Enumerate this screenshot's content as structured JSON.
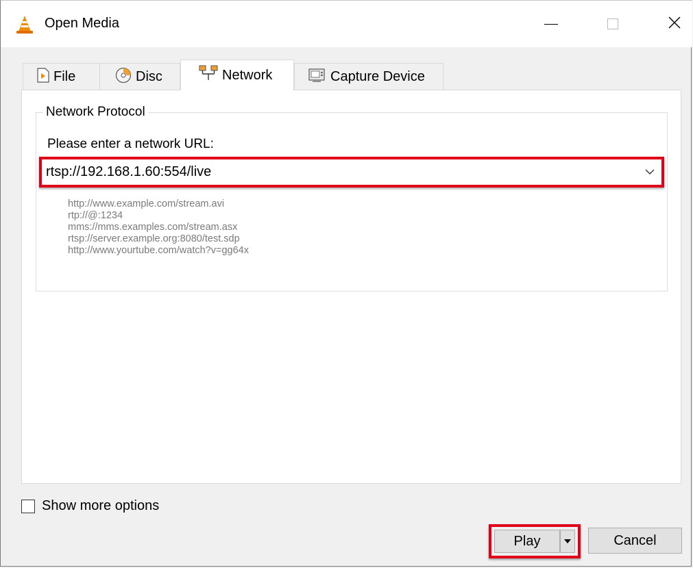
{
  "window": {
    "title": "Open Media",
    "app_icon": "vlc-cone-icon",
    "controls": [
      "minimize-icon",
      "maximize-icon",
      "close-icon"
    ]
  },
  "tabs": [
    {
      "label": "File",
      "icon": "file-play-icon"
    },
    {
      "label": "Disc",
      "icon": "disc-icon"
    },
    {
      "label": "Network",
      "icon": "network-icon",
      "active": true
    },
    {
      "label": "Capture Device",
      "icon": "capture-device-icon"
    }
  ],
  "network": {
    "group_label": "Network Protocol",
    "url_label": "Please enter a network URL:",
    "url_value": "rtsp://192.168.1.60:554/live",
    "examples": [
      "http://www.example.com/stream.avi",
      "rtp://@:1234",
      "mms://mms.examples.com/stream.asx",
      "rtsp://server.example.org:8080/test.sdp",
      "http://www.yourtube.com/watch?v=gg64x"
    ]
  },
  "options": {
    "show_more_label": "Show more options",
    "show_more_checked": false
  },
  "buttons": {
    "play_label": "Play",
    "cancel_label": "Cancel"
  },
  "colors": {
    "highlight": "#e0001a",
    "vlc_orange": "#f08a00"
  }
}
